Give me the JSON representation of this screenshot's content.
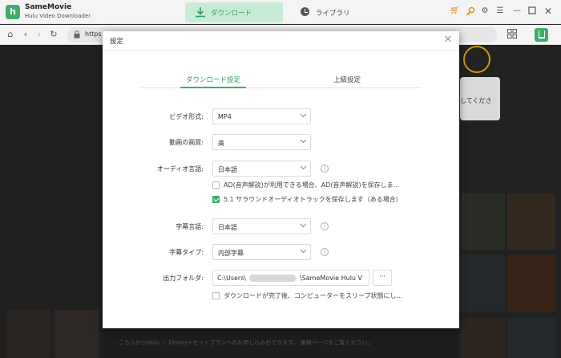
{
  "app": {
    "name": "SameMovie",
    "subtitle": "Hulu Video Downloader",
    "logo_letter": "h",
    "accent": "#3fae6a"
  },
  "titlebar": {
    "tabs": [
      {
        "label": "ダウンロード",
        "icon": "download-icon",
        "active": true
      },
      {
        "label": "ライブラリ",
        "icon": "clock-icon",
        "active": false
      }
    ],
    "icons": [
      "cart-icon",
      "key-icon",
      "gear-icon",
      "menu-icon",
      "minimize-icon",
      "maximize-icon",
      "close-icon"
    ]
  },
  "browser": {
    "url": "https",
    "icons": [
      "home-icon",
      "back-icon",
      "forward-icon",
      "reload-icon",
      "lock-icon",
      "grid-icon",
      "download-icon"
    ]
  },
  "webview": {
    "tooltip_text": "してくださ",
    "footer_text": "こちらからHulu ｜ Disney+セットプランへのお申し込みができます。 東映ページをご覧ください。"
  },
  "dialog": {
    "title": "設定",
    "tabs": [
      {
        "label": "ダウンロード設定",
        "active": true
      },
      {
        "label": "上級設定",
        "active": false
      }
    ],
    "fields": {
      "video_format": {
        "label": "ビデオ形式:",
        "value": "MP4"
      },
      "video_quality": {
        "label": "動画の画質:",
        "value": "高"
      },
      "audio_language": {
        "label": "オーディオ言語:",
        "value": "日本語"
      },
      "subtitle_language": {
        "label": "字幕言語:",
        "value": "日本語"
      },
      "subtitle_type": {
        "label": "字幕タイプ:",
        "value": "内部字幕"
      },
      "output_folder": {
        "label": "出力フォルダ:",
        "value_prefix": "C:\\Users\\",
        "value_suffix": "\\SameMovie Hulu V",
        "button": "···"
      }
    },
    "checkboxes": [
      {
        "label": "AD(音声解説)が利用できる場合、AD(音声解説)を保存しま...",
        "checked": false
      },
      {
        "label": "5.1 サラウンドオーディオトラックを保存します（ある場合）",
        "checked": true
      },
      {
        "label": "ダウンロードが完了後、コンピューターをスリープ状態にし...",
        "checked": false
      }
    ],
    "info_glyph": "i"
  }
}
